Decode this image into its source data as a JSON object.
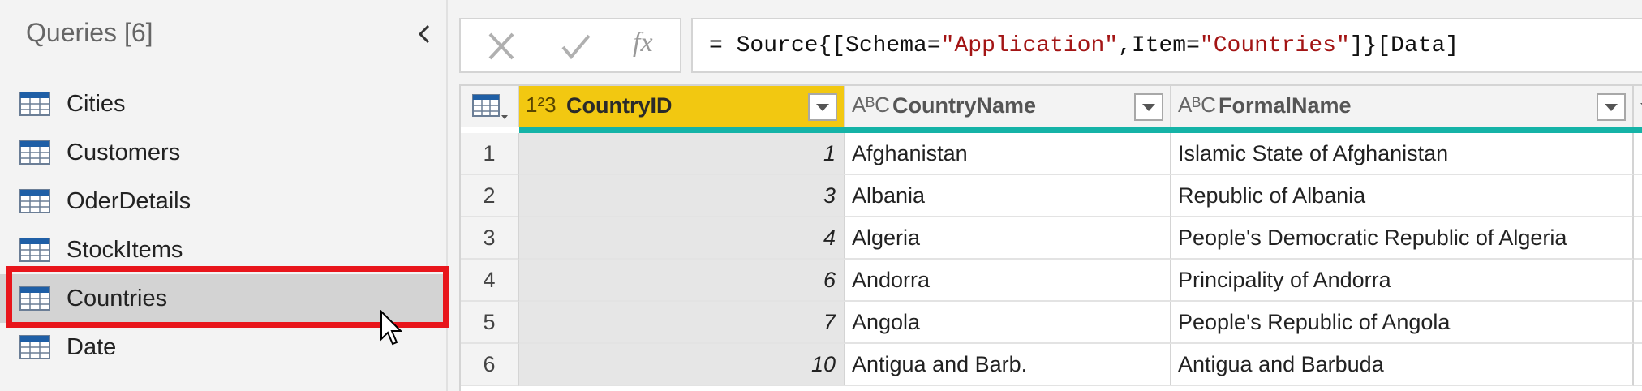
{
  "sidebar": {
    "title": "Queries [6]",
    "items": [
      {
        "label": "Cities",
        "icon": "table-icon"
      },
      {
        "label": "Customers",
        "icon": "table-icon"
      },
      {
        "label": "OderDetails",
        "icon": "table-icon"
      },
      {
        "label": "StockItems",
        "icon": "table-icon"
      },
      {
        "label": "Countries",
        "icon": "table-icon",
        "selected": true
      },
      {
        "label": "Date",
        "icon": "table-icon"
      }
    ]
  },
  "formula_bar": {
    "prefix": "= Source{[Schema=",
    "schema": "\"Application\"",
    "mid": ",Item=",
    "item": "\"Countries\"",
    "suffix": "]}[Data]",
    "fx_label": "fx"
  },
  "grid": {
    "columns": [
      {
        "name": "CountryID",
        "type": "1²3",
        "selected": true
      },
      {
        "name": "CountryName",
        "type": "AᴮC"
      },
      {
        "name": "FormalName",
        "type": "AᴮC"
      }
    ],
    "rows": [
      {
        "n": "1",
        "id": "1",
        "name": "Afghanistan",
        "formal": "Islamic State of Afghanistan"
      },
      {
        "n": "2",
        "id": "3",
        "name": "Albania",
        "formal": "Republic of Albania"
      },
      {
        "n": "3",
        "id": "4",
        "name": "Algeria",
        "formal": "People's Democratic Republic of Algeria"
      },
      {
        "n": "4",
        "id": "6",
        "name": "Andorra",
        "formal": "Principality of Andorra"
      },
      {
        "n": "5",
        "id": "7",
        "name": "Angola",
        "formal": "People's Republic of Angola"
      },
      {
        "n": "6",
        "id": "10",
        "name": "Antigua and Barb.",
        "formal": "Antigua and Barbuda"
      }
    ]
  },
  "colors": {
    "accent": "#f2c811",
    "quality_bar": "#15b3a7",
    "highlight": "#e8151b",
    "table_icon": "#1f5fa6"
  }
}
